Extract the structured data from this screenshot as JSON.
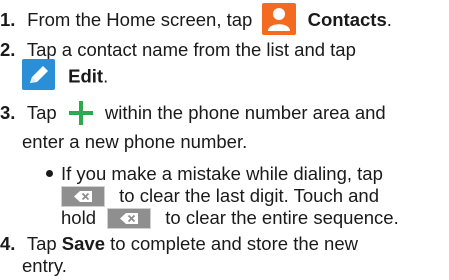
{
  "steps": [
    {
      "num": "1.",
      "text_before": "From the Home screen, tap",
      "icon": "contacts-person-icon",
      "label": "Contacts",
      "suffix": "."
    },
    {
      "num": "2.",
      "text_line1": "Tap a contact name from the list and tap",
      "icon": "edit-pencil-icon",
      "label": "Edit",
      "suffix": "."
    },
    {
      "num": "3.",
      "text_before": "Tap",
      "icon": "plus-icon",
      "text_after": "within the phone number area and",
      "text_line2": "enter a new phone number.",
      "bullet": {
        "line1": "If you make a mistake while dialing, tap",
        "icon": "backspace-icon",
        "line2_after_icon": "to clear the last digit. Touch and",
        "line3_before_icon": "hold",
        "line3_after_icon": "to clear the entire sequence."
      }
    },
    {
      "num": "4.",
      "text_before": "Tap",
      "label": "Save",
      "text_after": "to complete and store the new",
      "text_line2": "entry."
    }
  ],
  "colors": {
    "contacts_icon_bg": "#f26b21",
    "edit_icon_bg": "#2a8fd6",
    "plus_icon": "#2fa84f",
    "backspace_bg": "#8f8f8f"
  }
}
